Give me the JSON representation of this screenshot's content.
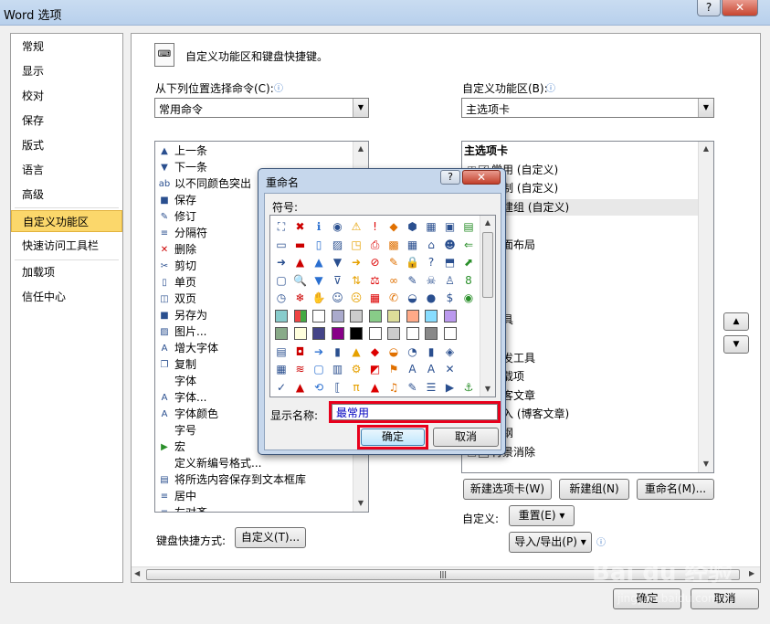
{
  "window": {
    "title": "Word 选项",
    "min": "–",
    "max": "□",
    "close": "✕"
  },
  "nav": {
    "items": [
      {
        "label": "常规"
      },
      {
        "label": "显示"
      },
      {
        "label": "校对"
      },
      {
        "label": "保存"
      },
      {
        "label": "版式"
      },
      {
        "label": "语言"
      },
      {
        "label": "高级"
      },
      {
        "label": "自定义功能区",
        "selected": true
      },
      {
        "label": "快速访问工具栏"
      },
      {
        "label": "加载项"
      },
      {
        "label": "信任中心"
      }
    ]
  },
  "header": {
    "text": "自定义功能区和键盘快捷键。"
  },
  "left": {
    "label": "从下列位置选择命令(C):",
    "combo": "常用命令",
    "commands": [
      {
        "icon": "up-arrow-icon",
        "label": "上一条",
        "g": "▲"
      },
      {
        "icon": "down-arrow-icon",
        "label": "下一条",
        "g": "▼"
      },
      {
        "icon": "highlight-icon",
        "label": "以不同颜色突出",
        "g": "ab"
      },
      {
        "icon": "save-icon",
        "label": "保存",
        "g": "■"
      },
      {
        "icon": "track-changes-icon",
        "label": "修订",
        "g": "✎"
      },
      {
        "icon": "break-icon",
        "label": "分隔符",
        "g": "≡"
      },
      {
        "icon": "delete-icon",
        "label": "删除",
        "g": "✕"
      },
      {
        "icon": "cut-icon",
        "label": "剪切",
        "g": "✂"
      },
      {
        "icon": "single-page-icon",
        "label": "单页",
        "g": "▯"
      },
      {
        "icon": "two-page-icon",
        "label": "双页",
        "g": "◫"
      },
      {
        "icon": "save-as-icon",
        "label": "另存为",
        "g": "■"
      },
      {
        "icon": "picture-icon",
        "label": "图片...",
        "g": "▨"
      },
      {
        "icon": "grow-font-icon",
        "label": "增大字体",
        "g": "A"
      },
      {
        "icon": "copy-icon",
        "label": "复制",
        "g": "❐"
      },
      {
        "icon": "none",
        "label": "字体",
        "g": ""
      },
      {
        "icon": "font-dialog-icon",
        "label": "字体...",
        "g": "A"
      },
      {
        "icon": "font-color-icon",
        "label": "字体颜色",
        "g": "A"
      },
      {
        "icon": "none",
        "label": "字号",
        "g": ""
      },
      {
        "icon": "macro-icon",
        "label": "宏",
        "g": "▶"
      },
      {
        "icon": "none",
        "label": "定义新编号格式...",
        "g": ""
      },
      {
        "icon": "save-textbox-icon",
        "label": "将所选内容保存到文本框库",
        "g": "▤"
      },
      {
        "icon": "center-icon",
        "label": "居中",
        "g": "≡"
      },
      {
        "icon": "align-left-icon",
        "label": "左对齐",
        "g": "≡"
      }
    ],
    "shortcut_label": "键盘快捷方式:",
    "shortcut_button": "自定义(T)..."
  },
  "right": {
    "label": "自定义功能区(B):",
    "combo": "主选项卡",
    "tree": [
      {
        "label": "主选项卡",
        "bold": true
      },
      {
        "label": "常用 (自定义)",
        "checked": true
      },
      {
        "label": "定制 (自定义)"
      },
      {
        "label": "新建组 (自定义)",
        "highlight": true
      },
      {
        "label": "式"
      },
      {
        "label": "页面布局"
      },
      {
        "label": "用"
      },
      {
        "label": "阅"
      },
      {
        "label": "图"
      },
      {
        "label": "工具"
      },
      {
        "label": "项"
      },
      {
        "label": "开发工具"
      },
      {
        "label": "加载项"
      },
      {
        "label": "博客文章"
      },
      {
        "label": "插入 (博客文章)"
      },
      {
        "label": "大纲"
      },
      {
        "label": "背景消除",
        "checked": true
      }
    ],
    "new_tab_button": "新建选项卡(W)",
    "new_group_button": "新建组(N)",
    "rename_button": "重命名(M)...",
    "customize_label": "自定义:",
    "reset_button": "重置(E) ▾",
    "import_export_button": "导入/导出(P) ▾"
  },
  "footer": {
    "ok": "确定",
    "cancel": "取消"
  },
  "dialog": {
    "title": "重命名",
    "help": "?",
    "close": "✕",
    "symbol_label": "符号:",
    "name_label": "显示名称:",
    "name_value": "最常用",
    "ok": "确定",
    "cancel": "取消"
  },
  "watermark": {
    "brand": "Bai du 经验",
    "url": "jingyan.baidu.com"
  }
}
